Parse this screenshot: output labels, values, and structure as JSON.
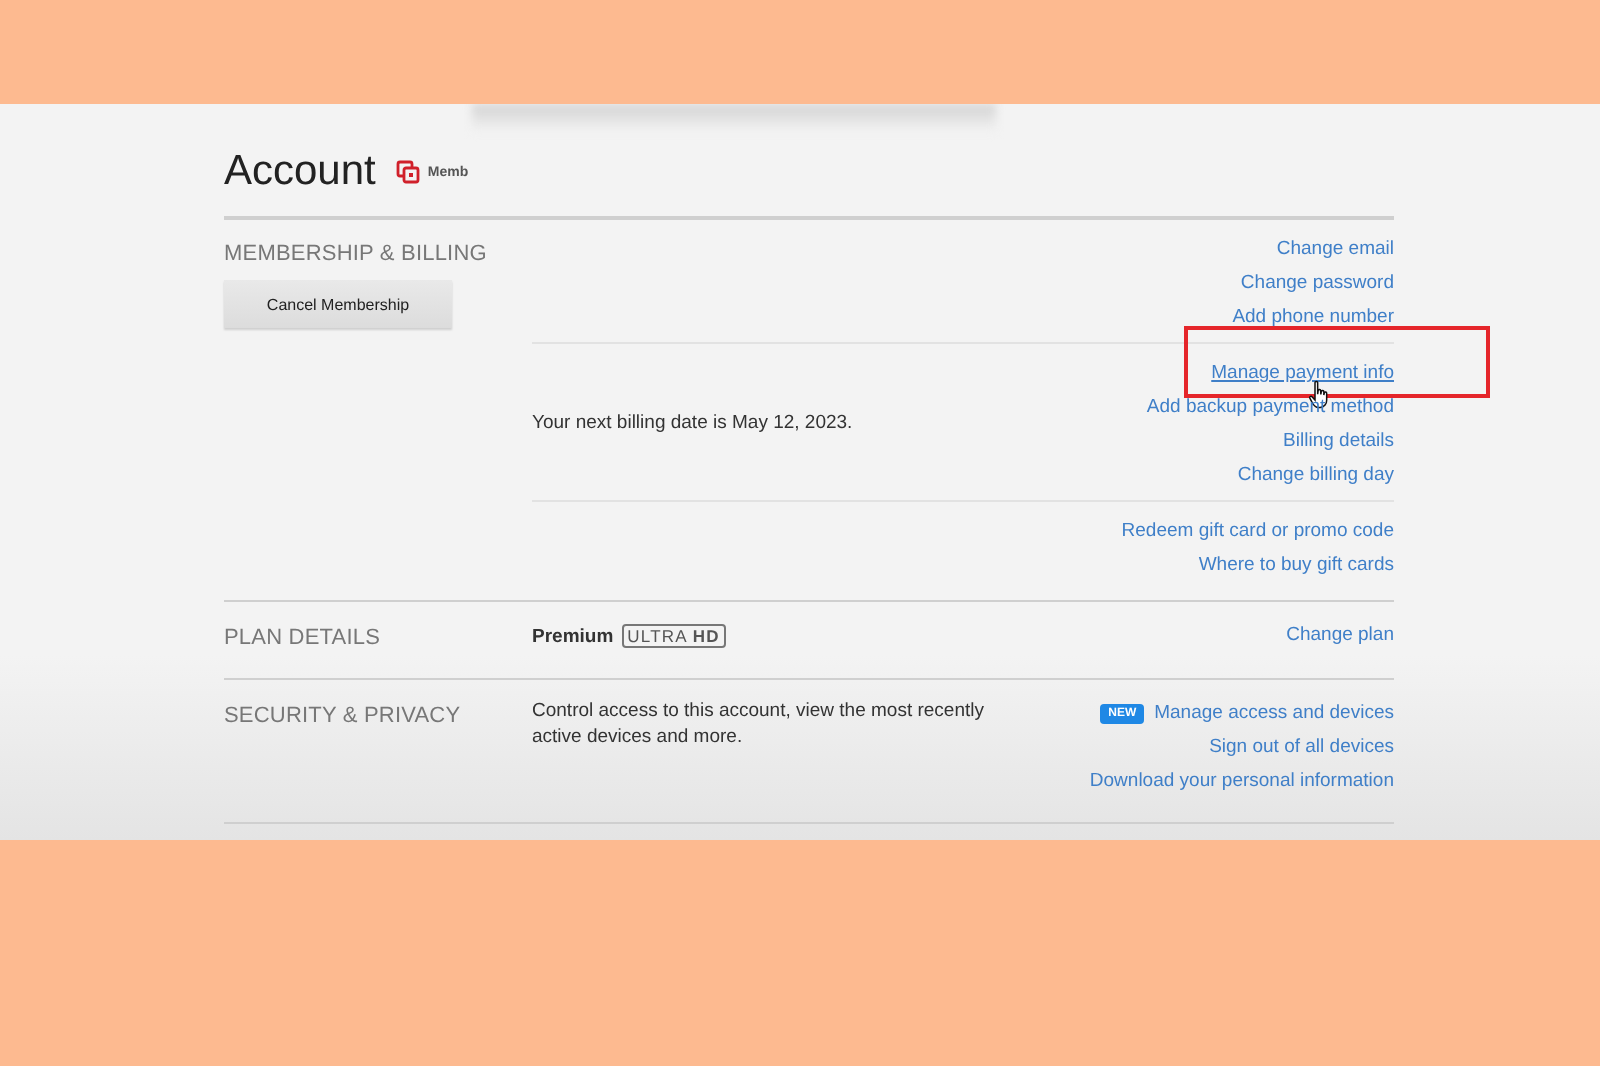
{
  "header": {
    "title": "Account",
    "member_badge": "Memb"
  },
  "membership": {
    "label": "MEMBERSHIP & BILLING",
    "button": "Cancel Membership",
    "groups": [
      {
        "links": [
          {
            "label": "Change email",
            "hovered": false
          },
          {
            "label": "Change password",
            "hovered": false
          },
          {
            "label": "Add phone number",
            "hovered": false
          }
        ]
      },
      {
        "text": "Your next billing date is May 12, 2023.",
        "links": [
          {
            "label": "Manage payment info",
            "hovered": true,
            "highlighted": true
          },
          {
            "label": "Add backup payment method",
            "hovered": false
          },
          {
            "label": "Billing details",
            "hovered": false
          },
          {
            "label": "Change billing day",
            "hovered": false
          }
        ]
      },
      {
        "links": [
          {
            "label": "Redeem gift card or promo code",
            "hovered": false
          },
          {
            "label": "Where to buy gift cards",
            "hovered": false
          }
        ]
      }
    ]
  },
  "plan": {
    "label": "PLAN DETAILS",
    "name": "Premium",
    "badge": "ULTRA **HD**",
    "links": [
      {
        "label": "Change plan",
        "hovered": false
      }
    ]
  },
  "security": {
    "label": "SECURITY & PRIVACY",
    "text": "Control access to this account, view the most recently active devices and more.",
    "links": [
      {
        "label": "Manage access and devices",
        "badge": "NEW",
        "hovered": false
      },
      {
        "label": "Sign out of all devices",
        "hovered": false
      },
      {
        "label": "Download your personal information",
        "hovered": false
      }
    ]
  }
}
